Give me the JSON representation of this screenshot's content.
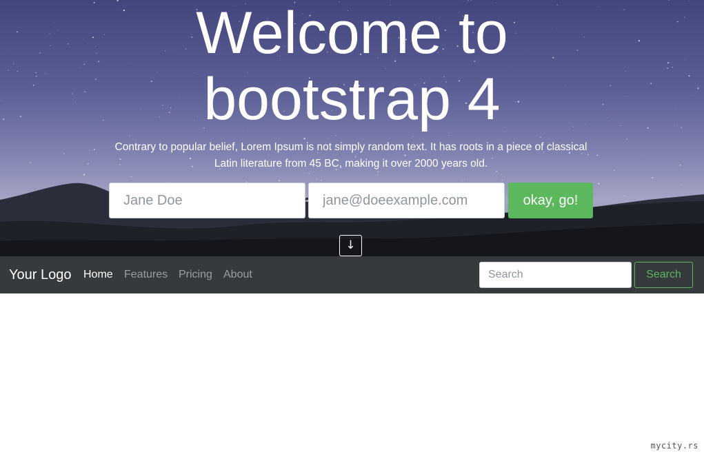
{
  "hero": {
    "title_line1": "Welcome to",
    "title_line2": "bootstrap 4",
    "subtitle": "Contrary to popular belief, Lorem Ipsum is not simply random text. It has roots in a piece of classical Latin literature from 45 BC, making it over 2000 years old.",
    "name_placeholder": "Jane Doe",
    "email_placeholder": "jane@doeexample.com",
    "submit_label": "okay, go!",
    "scroll_down_glyph": "↓"
  },
  "navbar": {
    "brand": "Your Logo",
    "links": [
      {
        "label": "Home",
        "active": true
      },
      {
        "label": "Features",
        "active": false
      },
      {
        "label": "Pricing",
        "active": false
      },
      {
        "label": "About",
        "active": false
      }
    ],
    "search_placeholder": "Search",
    "search_button": "Search"
  },
  "watermark": "mycity.rs",
  "colors": {
    "accent_green": "#5cb85c",
    "navbar_bg": "#363a3d",
    "sky_top": "#43467c"
  }
}
